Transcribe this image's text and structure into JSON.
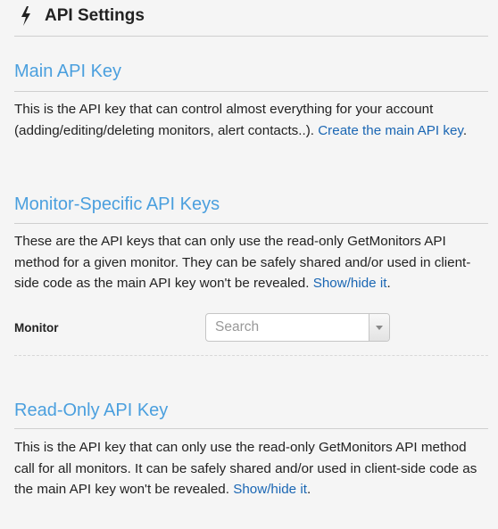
{
  "header": {
    "title": "API Settings",
    "icon": "lightning-bolt-icon"
  },
  "main_api_key": {
    "title": "Main API Key",
    "description": "This is the API key that can control almost everything for your account (adding/editing/deleting monitors, alert contacts..). ",
    "link_text": "Create the main API key",
    "trailing": "."
  },
  "monitor_specific_keys": {
    "title": "Monitor-Specific API Keys",
    "description": "These are the API keys that can only use the read-only GetMonitors API method for a given monitor. They can be safely shared and/or used in client-side code as the main API key won't be revealed. ",
    "link_text": "Show/hide it",
    "trailing": ".",
    "monitor_label": "Monitor",
    "monitor_select": {
      "placeholder": "Search"
    }
  },
  "read_only_key": {
    "title": "Read-Only API Key",
    "description": "This is the API key that can only use the read-only GetMonitors API method call for all monitors. It can be safely shared and/or used in client-side code as the main API key won't be revealed. ",
    "link_text": "Show/hide it",
    "trailing": "."
  },
  "colors": {
    "section_title": "#4a9fde",
    "link": "#1a66b3",
    "background": "#f5f5f5"
  }
}
